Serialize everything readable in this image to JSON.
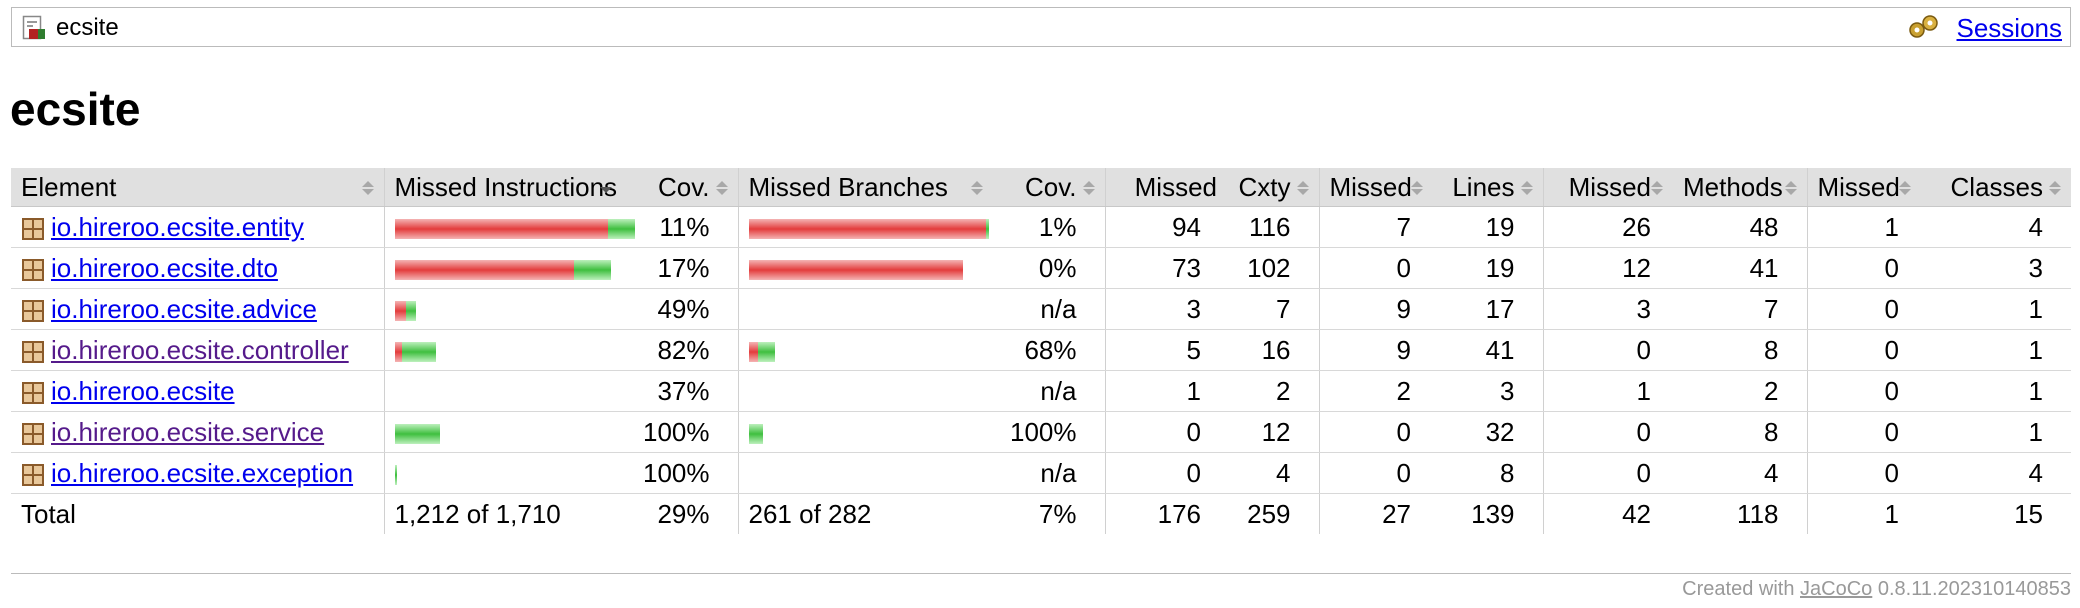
{
  "breadcrumb": {
    "name": "ecsite",
    "sessions_label": "Sessions"
  },
  "page_title": "ecsite",
  "table": {
    "headers": {
      "element": "Element",
      "missed_instructions": "Missed Instructions",
      "cov_instructions": "Cov.",
      "missed_branches": "Missed Branches",
      "cov_branches": "Cov.",
      "missed_cxty": "Missed",
      "cxty": "Cxty",
      "missed_lines": "Missed",
      "lines": "Lines",
      "missed_methods": "Missed",
      "methods": "Methods",
      "missed_classes": "Missed",
      "classes": "Classes"
    },
    "rows": [
      {
        "name": "io.hireroo.ecsite.entity",
        "visited": false,
        "instr_bar": {
          "missed": 1071,
          "covered": 138
        },
        "instr_cov": "11%",
        "branch_bar": {
          "missed": 186,
          "covered": 2
        },
        "branch_cov": "1%",
        "missed_cxty": "94",
        "cxty": "116",
        "missed_lines": "7",
        "lines": "19",
        "missed_methods": "26",
        "methods": "48",
        "missed_classes": "1",
        "classes": "4"
      },
      {
        "name": "io.hireroo.ecsite.dto",
        "visited": false,
        "instr_bar": {
          "missed": 904,
          "covered": 185
        },
        "instr_cov": "17%",
        "branch_bar": {
          "missed": 168,
          "covered": 0
        },
        "branch_cov": "0%",
        "missed_cxty": "73",
        "cxty": "102",
        "missed_lines": "0",
        "lines": "19",
        "missed_methods": "12",
        "methods": "41",
        "missed_classes": "0",
        "classes": "3"
      },
      {
        "name": "io.hireroo.ecsite.advice",
        "visited": false,
        "instr_bar": {
          "missed": 54,
          "covered": 52
        },
        "instr_cov": "49%",
        "branch_bar": null,
        "branch_cov": "n/a",
        "missed_cxty": "3",
        "cxty": "7",
        "missed_lines": "9",
        "lines": "17",
        "missed_methods": "3",
        "methods": "7",
        "missed_classes": "0",
        "classes": "1"
      },
      {
        "name": "io.hireroo.ecsite.controller",
        "visited": true,
        "instr_bar": {
          "missed": 37,
          "covered": 170
        },
        "instr_cov": "82%",
        "branch_bar": {
          "missed": 7,
          "covered": 13
        },
        "branch_cov": "68%",
        "missed_cxty": "5",
        "cxty": "16",
        "missed_lines": "9",
        "lines": "41",
        "missed_methods": "0",
        "methods": "8",
        "missed_classes": "0",
        "classes": "1"
      },
      {
        "name": "io.hireroo.ecsite",
        "visited": false,
        "instr_bar": null,
        "instr_cov": "37%",
        "branch_bar": null,
        "branch_cov": "n/a",
        "missed_cxty": "1",
        "cxty": "2",
        "missed_lines": "2",
        "lines": "3",
        "missed_methods": "1",
        "methods": "2",
        "missed_classes": "0",
        "classes": "1"
      },
      {
        "name": "io.hireroo.ecsite.service",
        "visited": true,
        "instr_bar": {
          "missed": 0,
          "covered": 225
        },
        "instr_cov": "100%",
        "branch_bar": {
          "missed": 0,
          "covered": 11
        },
        "branch_cov": "100%",
        "missed_cxty": "0",
        "cxty": "12",
        "missed_lines": "0",
        "lines": "32",
        "missed_methods": "0",
        "methods": "8",
        "missed_classes": "0",
        "classes": "1"
      },
      {
        "name": "io.hireroo.ecsite.exception",
        "visited": false,
        "instr_bar": {
          "missed": 0,
          "covered": 12
        },
        "instr_cov": "100%",
        "branch_bar": null,
        "branch_cov": "n/a",
        "missed_cxty": "0",
        "cxty": "4",
        "missed_lines": "0",
        "lines": "8",
        "missed_methods": "0",
        "methods": "4",
        "missed_classes": "0",
        "classes": "4"
      }
    ],
    "total": {
      "label": "Total",
      "instructions": "1,212 of 1,710",
      "instr_cov": "29%",
      "branches": "261 of 282",
      "branch_cov": "7%",
      "missed_cxty": "176",
      "cxty": "259",
      "missed_lines": "27",
      "lines": "139",
      "missed_methods": "42",
      "methods": "118",
      "missed_classes": "1",
      "classes": "15"
    }
  },
  "footer": {
    "prefix": "Created with",
    "link": "JaCoCo",
    "version": "0.8.11.202310140853"
  },
  "colors": {
    "missed": "#e33c3c",
    "covered": "#3fbf3f",
    "link": "#0000ee",
    "visited_link": "#551a8b"
  },
  "icons": {
    "breadcrumb": "report-icon",
    "sessions": "gears-icon",
    "package": "package-icon"
  }
}
